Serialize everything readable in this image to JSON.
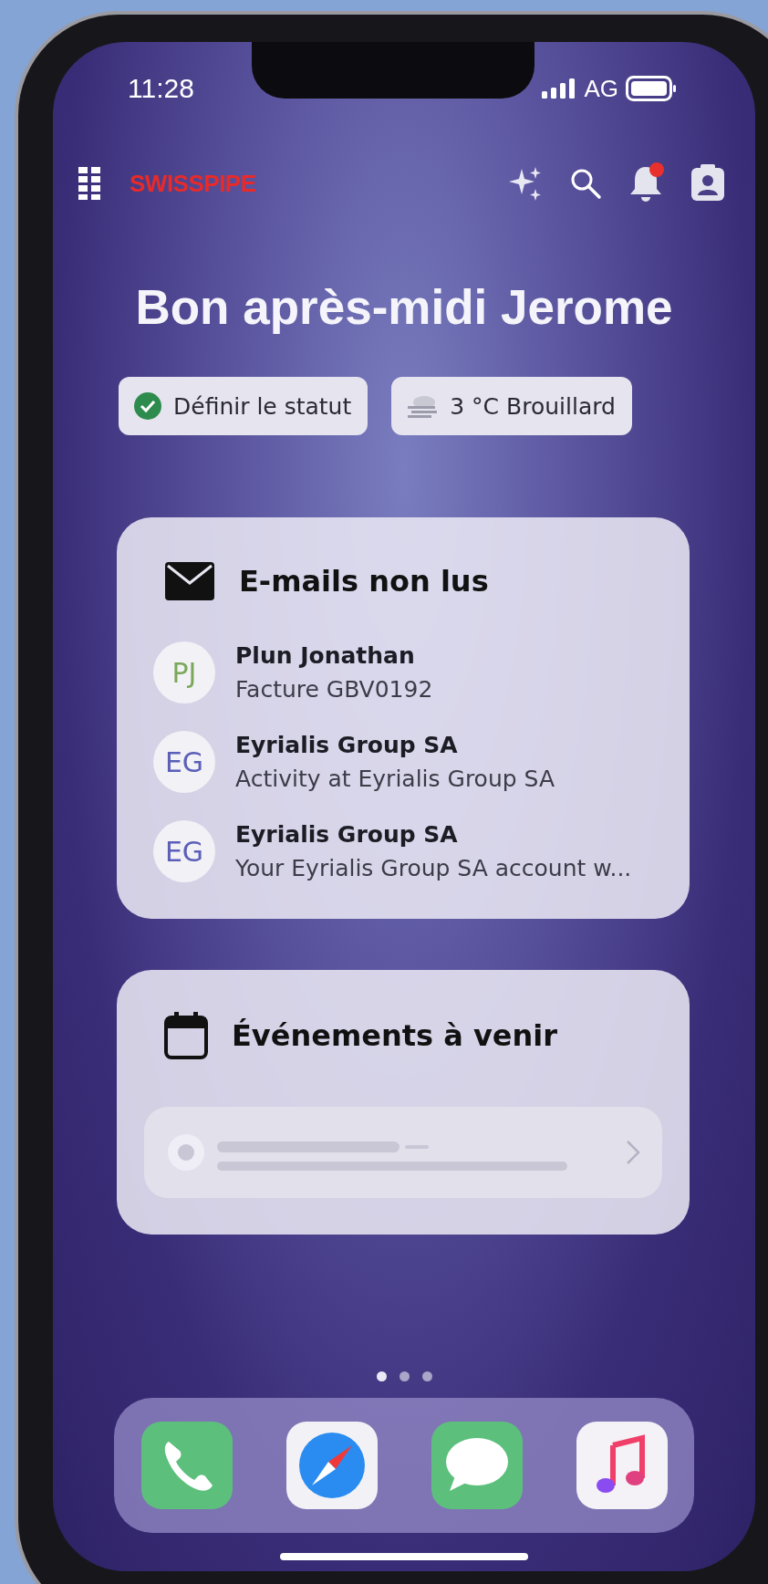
{
  "status_bar": {
    "time": "11:28",
    "carrier": "AG"
  },
  "header": {
    "logo": "SWISSPIPE",
    "notification_badge": true
  },
  "greeting": "Bon après-midi Jerome",
  "chips": [
    {
      "kind": "status",
      "label": "Définir le statut"
    },
    {
      "kind": "weather",
      "label": "3 °C Brouillard"
    }
  ],
  "emails_card": {
    "title": "E-mails non lus",
    "items": [
      {
        "initials": "PJ",
        "color": "#7aa85a",
        "sender": "Plun Jonathan",
        "subject": "Facture GBV0192"
      },
      {
        "initials": "EG",
        "color": "#5b5fb8",
        "sender": "Eyrialis Group SA",
        "subject": "Activity at Eyrialis Group SA"
      },
      {
        "initials": "EG",
        "color": "#5b5fb8",
        "sender": "Eyrialis Group SA",
        "subject": "Your Eyrialis Group SA account w..."
      }
    ]
  },
  "events_card": {
    "title": "Événements à venir"
  },
  "page_dots": [
    {
      "selected": true
    },
    {
      "selected": false
    },
    {
      "selected": false
    }
  ],
  "dock": [
    {
      "kind": "phone"
    },
    {
      "kind": "browser"
    },
    {
      "kind": "messages"
    },
    {
      "kind": "music"
    }
  ]
}
